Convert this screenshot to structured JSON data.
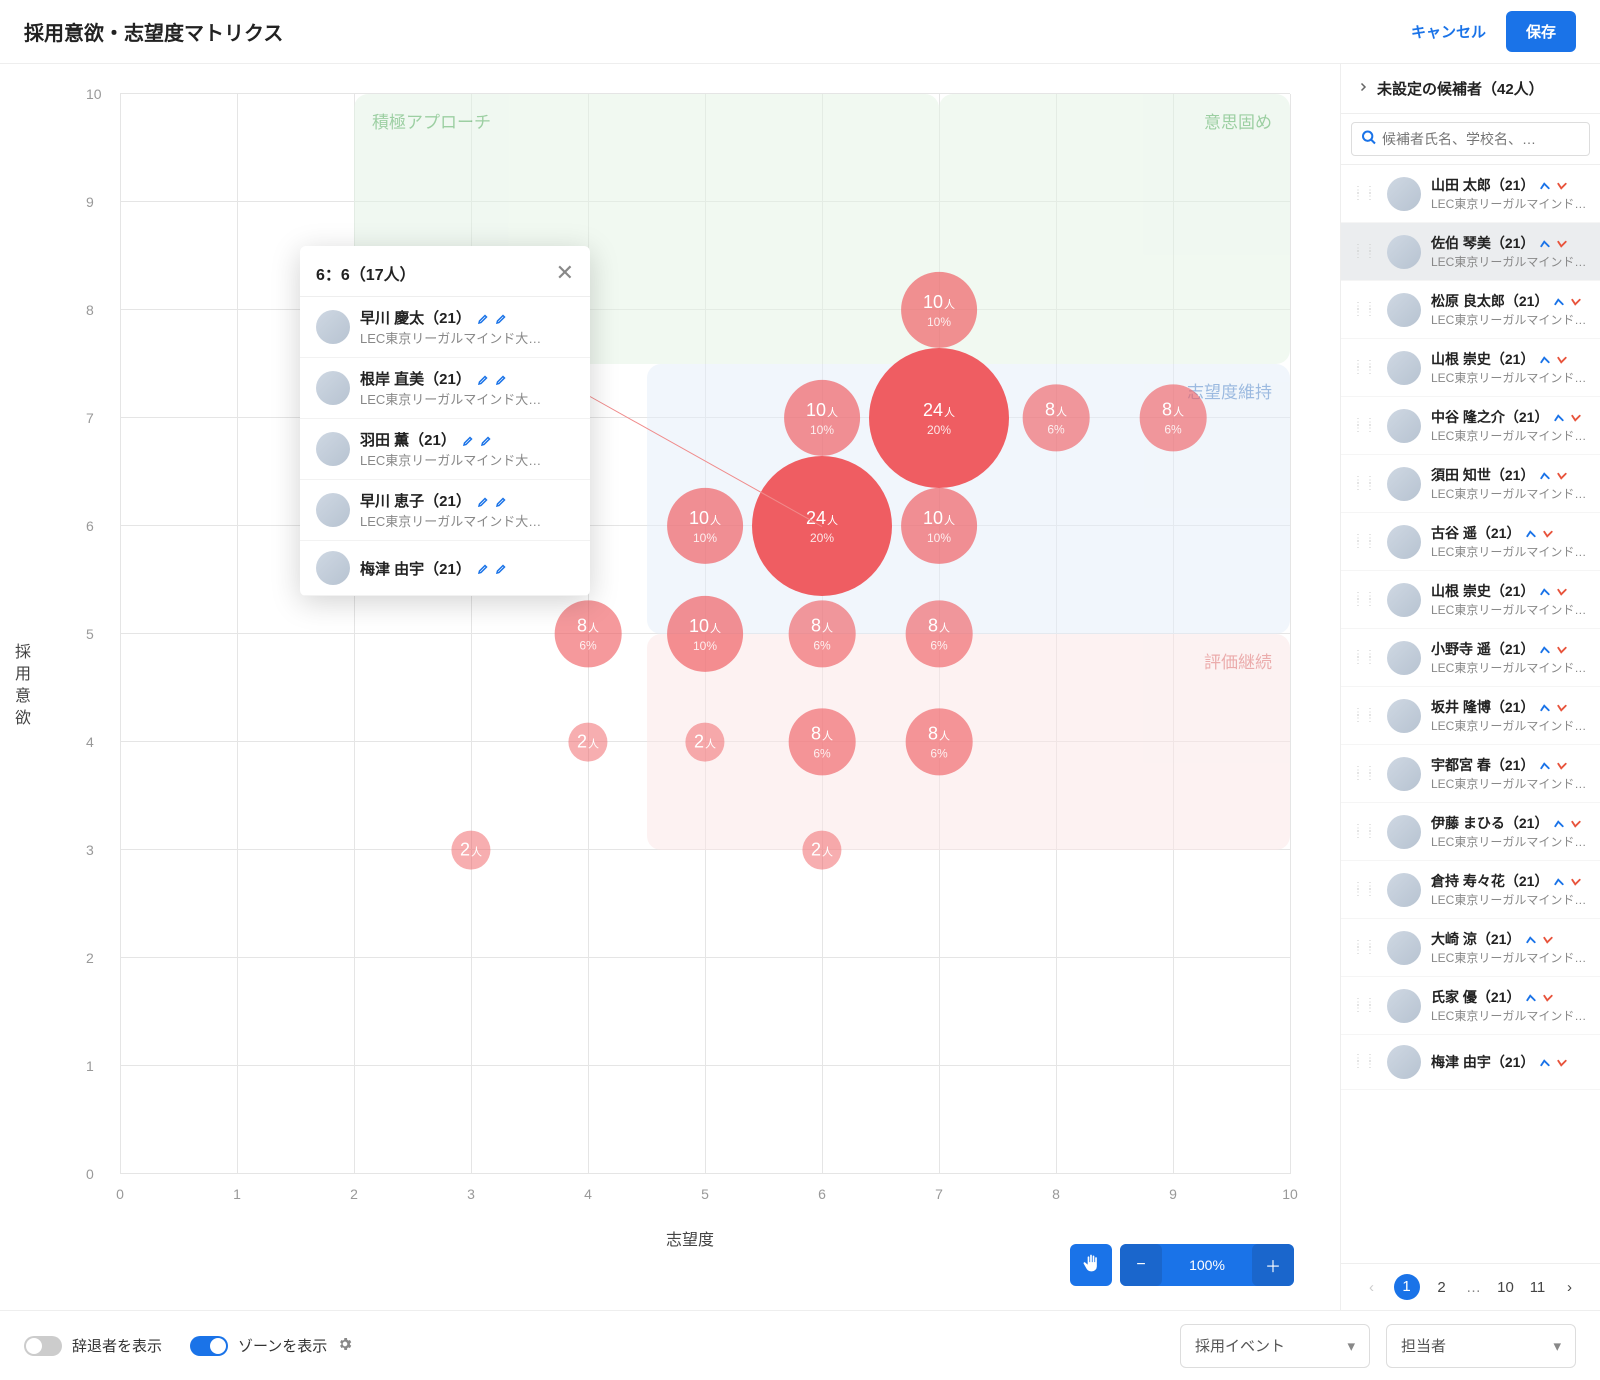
{
  "header": {
    "title": "採用意欲・志望度マトリクス",
    "cancel": "キャンセル",
    "save": "保存"
  },
  "chart_data": {
    "type": "scatter",
    "xlabel": "志望度",
    "ylabel": "採用意欲",
    "xlim": [
      0,
      10
    ],
    "ylim": [
      0,
      10
    ],
    "x_ticks": [
      0,
      1,
      2,
      3,
      4,
      5,
      6,
      7,
      8,
      9,
      10
    ],
    "y_ticks": [
      0,
      1,
      2,
      3,
      4,
      5,
      6,
      7,
      8,
      9,
      10
    ],
    "zones": [
      {
        "label": "積極アプローチ",
        "kind": "green",
        "x": [
          2,
          7
        ],
        "y": [
          7.5,
          10
        ],
        "align": "top-left"
      },
      {
        "label": "意思固め",
        "kind": "green",
        "x": [
          7,
          10
        ],
        "y": [
          7.5,
          10
        ],
        "align": "top-right"
      },
      {
        "label": "志望度維持",
        "kind": "blue",
        "x": [
          4.5,
          10
        ],
        "y": [
          5,
          7.5
        ],
        "align": "top-right"
      },
      {
        "label": "評価継続",
        "kind": "red",
        "x": [
          4.5,
          10
        ],
        "y": [
          3,
          5
        ],
        "align": "top-right"
      }
    ],
    "bubbles": [
      {
        "x": 7,
        "y": 8,
        "count": 10,
        "pct": "10%"
      },
      {
        "x": 6,
        "y": 7,
        "count": 10,
        "pct": "10%"
      },
      {
        "x": 7,
        "y": 7,
        "count": 24,
        "pct": "20%"
      },
      {
        "x": 8,
        "y": 7,
        "count": 8,
        "pct": "6%"
      },
      {
        "x": 9,
        "y": 7,
        "count": 8,
        "pct": "6%"
      },
      {
        "x": 5,
        "y": 6,
        "count": 10,
        "pct": "10%"
      },
      {
        "x": 6,
        "y": 6,
        "count": 24,
        "pct": "20%"
      },
      {
        "x": 7,
        "y": 6,
        "count": 10,
        "pct": "10%"
      },
      {
        "x": 4,
        "y": 5,
        "count": 8,
        "pct": "6%"
      },
      {
        "x": 5,
        "y": 5,
        "count": 10,
        "pct": "10%"
      },
      {
        "x": 6,
        "y": 5,
        "count": 8,
        "pct": "6%"
      },
      {
        "x": 7,
        "y": 5,
        "count": 8,
        "pct": "6%"
      },
      {
        "x": 4,
        "y": 4,
        "count": 2,
        "pct": ""
      },
      {
        "x": 5,
        "y": 4,
        "count": 2,
        "pct": ""
      },
      {
        "x": 6,
        "y": 4,
        "count": 8,
        "pct": "6%"
      },
      {
        "x": 7,
        "y": 4,
        "count": 8,
        "pct": "6%"
      },
      {
        "x": 3,
        "y": 3,
        "count": 2,
        "pct": ""
      },
      {
        "x": 6,
        "y": 3,
        "count": 2,
        "pct": ""
      }
    ]
  },
  "popover": {
    "title": "6：6（17人）",
    "items": [
      {
        "name": "早川 慶太（21）",
        "school": "LEC東京リーガルマインド大…",
        "trends": [
          "blue",
          "blue"
        ]
      },
      {
        "name": "根岸 直美（21）",
        "school": "LEC東京リーガルマインド大…",
        "trends": [
          "blue",
          "blue"
        ]
      },
      {
        "name": "羽田 薫（21）",
        "school": "LEC東京リーガルマインド大…",
        "trends": [
          "blue",
          "blue"
        ]
      },
      {
        "name": "早川 恵子（21）",
        "school": "LEC東京リーガルマインド大…",
        "trends": [
          "blue",
          "blue"
        ]
      },
      {
        "name": "梅津 由宇（21）",
        "school": "",
        "trends": [
          "blue",
          "blue"
        ]
      }
    ]
  },
  "sidebar": {
    "header": "未設定の候補者（42人）",
    "search_placeholder": "候補者氏名、学校名、…",
    "items": [
      {
        "name": "山田 太郎（21）",
        "school": "LEC東京リーガルマインド大…",
        "trends": [
          "blue",
          "red"
        ],
        "selected": false
      },
      {
        "name": "佐伯 琴美（21）",
        "school": "LEC東京リーガルマインド大…",
        "trends": [
          "blue",
          "red"
        ],
        "selected": true
      },
      {
        "name": "松原 良太郎（21）",
        "school": "LEC東京リーガルマインド大…",
        "trends": [
          "blue",
          "red"
        ],
        "selected": false
      },
      {
        "name": "山根 崇史（21）",
        "school": "LEC東京リーガルマインド大…",
        "trends": [
          "blue",
          "red"
        ],
        "selected": false
      },
      {
        "name": "中谷 隆之介（21）",
        "school": "LEC東京リーガルマインド大…",
        "trends": [
          "blue",
          "red"
        ],
        "selected": false
      },
      {
        "name": "須田 知世（21）",
        "school": "LEC東京リーガルマインド大…",
        "trends": [
          "blue",
          "red"
        ],
        "selected": false
      },
      {
        "name": "古谷 遥（21）",
        "school": "LEC東京リーガルマインド大…",
        "trends": [
          "blue",
          "red"
        ],
        "selected": false
      },
      {
        "name": "山根 崇史（21）",
        "school": "LEC東京リーガルマインド大…",
        "trends": [
          "blue",
          "red"
        ],
        "selected": false
      },
      {
        "name": "小野寺 遥（21）",
        "school": "LEC東京リーガルマインド大…",
        "trends": [
          "blue",
          "red"
        ],
        "selected": false
      },
      {
        "name": "坂井 隆博（21）",
        "school": "LEC東京リーガルマインド大…",
        "trends": [
          "blue",
          "red"
        ],
        "selected": false
      },
      {
        "name": "宇都宮 春（21）",
        "school": "LEC東京リーガルマインド大…",
        "trends": [
          "blue",
          "red"
        ],
        "selected": false
      },
      {
        "name": "伊藤 まひる（21）",
        "school": "LEC東京リーガルマインド大…",
        "trends": [
          "blue",
          "red"
        ],
        "selected": false
      },
      {
        "name": "倉持 寿々花（21）",
        "school": "LEC東京リーガルマインド大…",
        "trends": [
          "blue",
          "red"
        ],
        "selected": false
      },
      {
        "name": "大崎 涼（21）",
        "school": "LEC東京リーガルマインド大…",
        "trends": [
          "blue",
          "red"
        ],
        "selected": false
      },
      {
        "name": "氏家 優（21）",
        "school": "LEC東京リーガルマインド大…",
        "trends": [
          "blue",
          "red"
        ],
        "selected": false
      },
      {
        "name": "梅津 由宇（21）",
        "school": "",
        "trends": [
          "blue",
          "red"
        ],
        "selected": false
      }
    ],
    "pager": {
      "pages": [
        "1",
        "2",
        "…",
        "10",
        "11"
      ],
      "active": 0
    }
  },
  "controls": {
    "zoom": "100%"
  },
  "footer": {
    "toggle_withdrawn": "辞退者を表示",
    "toggle_zones": "ゾーンを表示",
    "select_event": "採用イベント",
    "select_assignee": "担当者"
  },
  "count_unit": "人"
}
